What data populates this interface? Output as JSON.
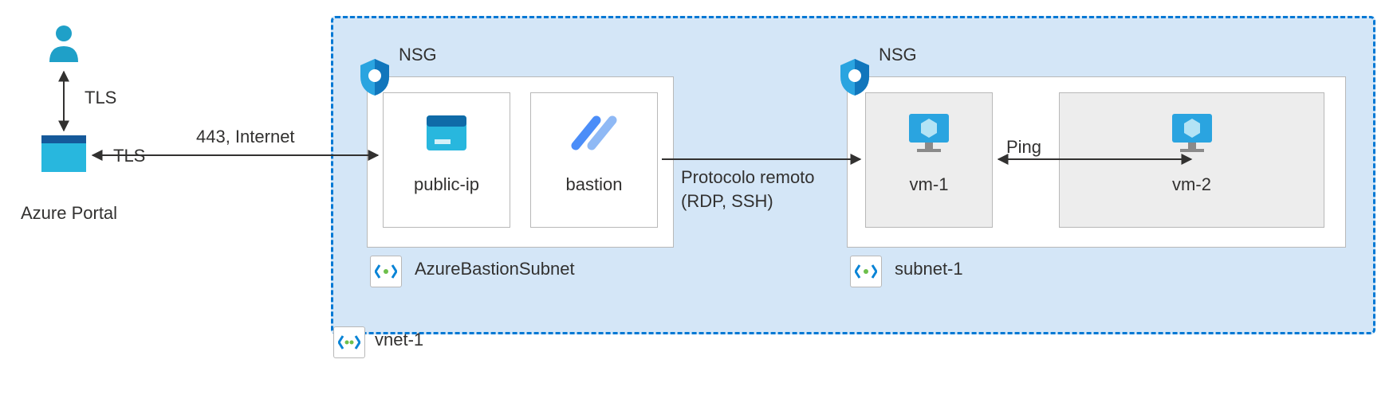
{
  "user": {
    "tls_label": "TLS"
  },
  "portal": {
    "label": "Azure Portal",
    "connection_tls": "TLS",
    "connection_port": "443, Internet"
  },
  "vnet": {
    "name": "vnet-1",
    "subnets": {
      "bastion": {
        "nsg": "NSG",
        "name": "AzureBastionSubnet",
        "nodes": {
          "public_ip": "public-ip",
          "bastion": "bastion"
        }
      },
      "subnet1": {
        "nsg": "NSG",
        "name": "subnet-1",
        "nodes": {
          "vm1": "vm-1",
          "vm2": "vm-2"
        }
      }
    },
    "remote_protocol_line1": "Protocolo remoto",
    "remote_protocol_line2": "(RDP, SSH)",
    "ping_label": "Ping"
  }
}
